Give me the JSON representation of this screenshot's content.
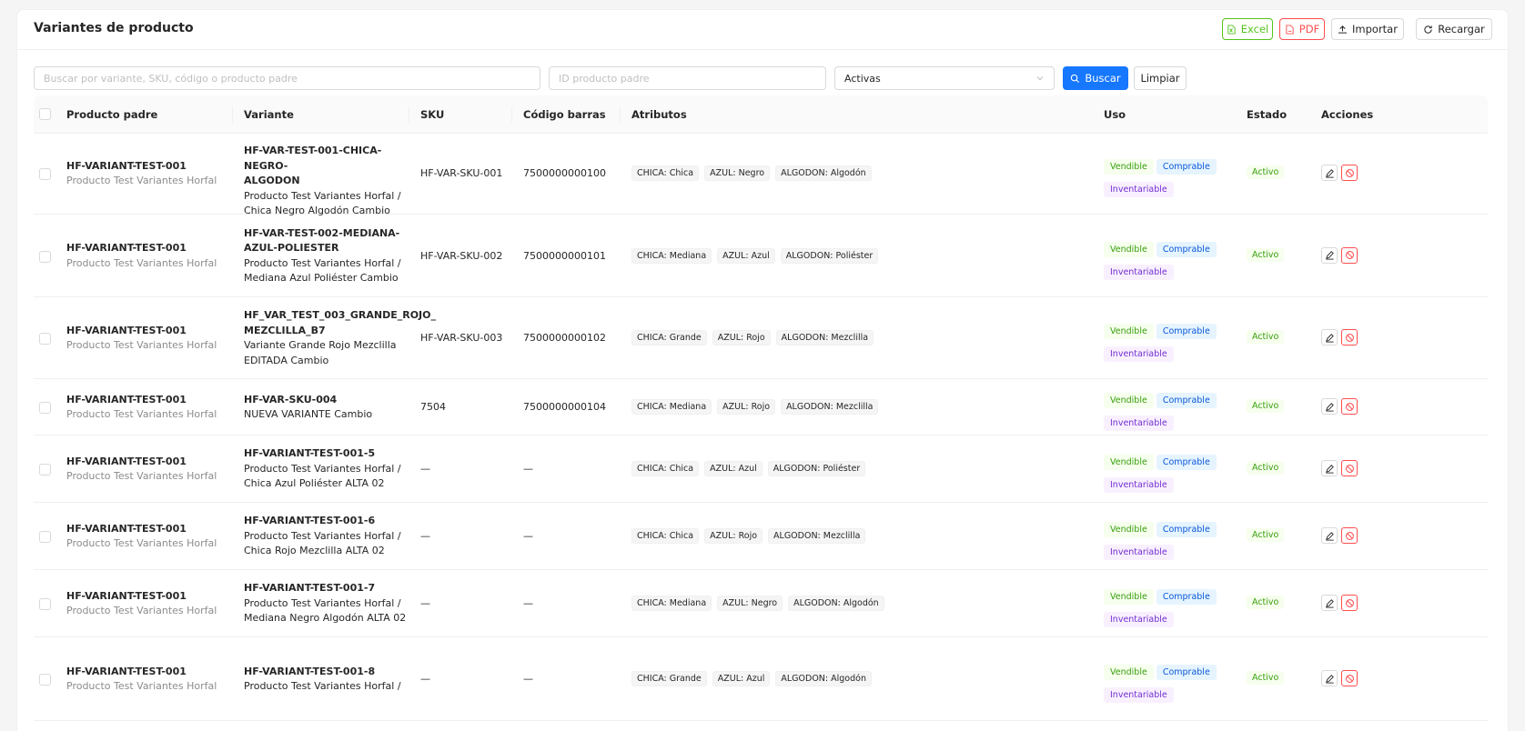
{
  "page": {
    "title": "Variantes de producto"
  },
  "toolbar": {
    "excel": "Excel",
    "pdf": "PDF",
    "importar": "Importar",
    "recargar": "Recargar"
  },
  "filters": {
    "search_placeholder": "Buscar por variante, SKU, código o producto padre",
    "parent_placeholder": "ID producto padre",
    "status_value": "Activas",
    "buscar": "Buscar",
    "limpiar": "Limpiar"
  },
  "columns": {
    "producto": "Producto padre",
    "variante": "Variante",
    "sku": "SKU",
    "barcode": "Código barras",
    "atributos": "Atributos",
    "uso": "Uso",
    "estado": "Estado",
    "acciones": "Acciones"
  },
  "uso_labels": {
    "vendible": "Vendible",
    "comprable": "Comprable",
    "inventariable": "Inventariable"
  },
  "estado_label": "Activo",
  "rows": [
    {
      "parent_code": "HF-VARIANT-TEST-001",
      "parent_name": "Producto Test Variantes Horfal",
      "var_code": [
        "HF-VAR-TEST-001-CHICA-NEGRO-",
        "ALGODON"
      ],
      "var_name": [
        "Producto Test Variantes Horfal /",
        "Chica Negro Algodón Cambio"
      ],
      "sku": "HF-VAR-SKU-001",
      "barcode": "7500000000100",
      "attrs": [
        "CHICA: Chica",
        "AZUL: Negro",
        "ALGODON: Algodón"
      ]
    },
    {
      "parent_code": "HF-VARIANT-TEST-001",
      "parent_name": "Producto Test Variantes Horfal",
      "var_code": [
        "HF-VAR-TEST-002-MEDIANA-",
        "AZUL-POLIESTER"
      ],
      "var_name": [
        "Producto Test Variantes Horfal /",
        "Mediana Azul Poliéster Cambio"
      ],
      "sku": "HF-VAR-SKU-002",
      "barcode": "7500000000101",
      "attrs": [
        "CHICA: Mediana",
        "AZUL: Azul",
        "ALGODON: Poliéster"
      ]
    },
    {
      "parent_code": "HF-VARIANT-TEST-001",
      "parent_name": "Producto Test Variantes Horfal",
      "var_code": [
        "HF_VAR_TEST_003_GRANDE_ROJO_",
        "MEZCLILLA_B7"
      ],
      "var_name": [
        "Variante Grande Rojo Mezclilla",
        "EDITADA Cambio"
      ],
      "sku": "HF-VAR-SKU-003",
      "barcode": "7500000000102",
      "attrs": [
        "CHICA: Grande",
        "AZUL: Rojo",
        "ALGODON: Mezclilla"
      ]
    },
    {
      "parent_code": "HF-VARIANT-TEST-001",
      "parent_name": "Producto Test Variantes Horfal",
      "var_code": [
        "HF-VAR-SKU-004"
      ],
      "var_name": [
        "NUEVA VARIANTE Cambio"
      ],
      "sku": "7504",
      "barcode": "7500000000104",
      "attrs": [
        "CHICA: Mediana",
        "AZUL: Rojo",
        "ALGODON: Mezclilla"
      ]
    },
    {
      "parent_code": "HF-VARIANT-TEST-001",
      "parent_name": "Producto Test Variantes Horfal",
      "var_code": [
        "HF-VARIANT-TEST-001-5"
      ],
      "var_name": [
        "Producto Test Variantes Horfal /",
        "Chica Azul Poliéster ALTA 02"
      ],
      "sku": "—",
      "barcode": "—",
      "attrs": [
        "CHICA: Chica",
        "AZUL: Azul",
        "ALGODON: Poliéster"
      ]
    },
    {
      "parent_code": "HF-VARIANT-TEST-001",
      "parent_name": "Producto Test Variantes Horfal",
      "var_code": [
        "HF-VARIANT-TEST-001-6"
      ],
      "var_name": [
        "Producto Test Variantes Horfal /",
        "Chica Rojo Mezclilla ALTA 02"
      ],
      "sku": "—",
      "barcode": "—",
      "attrs": [
        "CHICA: Chica",
        "AZUL: Rojo",
        "ALGODON: Mezclilla"
      ]
    },
    {
      "parent_code": "HF-VARIANT-TEST-001",
      "parent_name": "Producto Test Variantes Horfal",
      "var_code": [
        "HF-VARIANT-TEST-001-7"
      ],
      "var_name": [
        "Producto Test Variantes Horfal /",
        "Mediana Negro Algodón ALTA 02"
      ],
      "sku": "—",
      "barcode": "—",
      "attrs": [
        "CHICA: Mediana",
        "AZUL: Negro",
        "ALGODON: Algodón"
      ]
    },
    {
      "parent_code": "HF-VARIANT-TEST-001",
      "parent_name": "Producto Test Variantes Horfal",
      "var_code": [
        "HF-VARIANT-TEST-001-8"
      ],
      "var_name": [
        "Producto Test Variantes Horfal /"
      ],
      "sku": "—",
      "barcode": "—",
      "attrs": [
        "CHICA: Grande",
        "AZUL: Azul",
        "ALGODON: Algodón"
      ]
    }
  ]
}
